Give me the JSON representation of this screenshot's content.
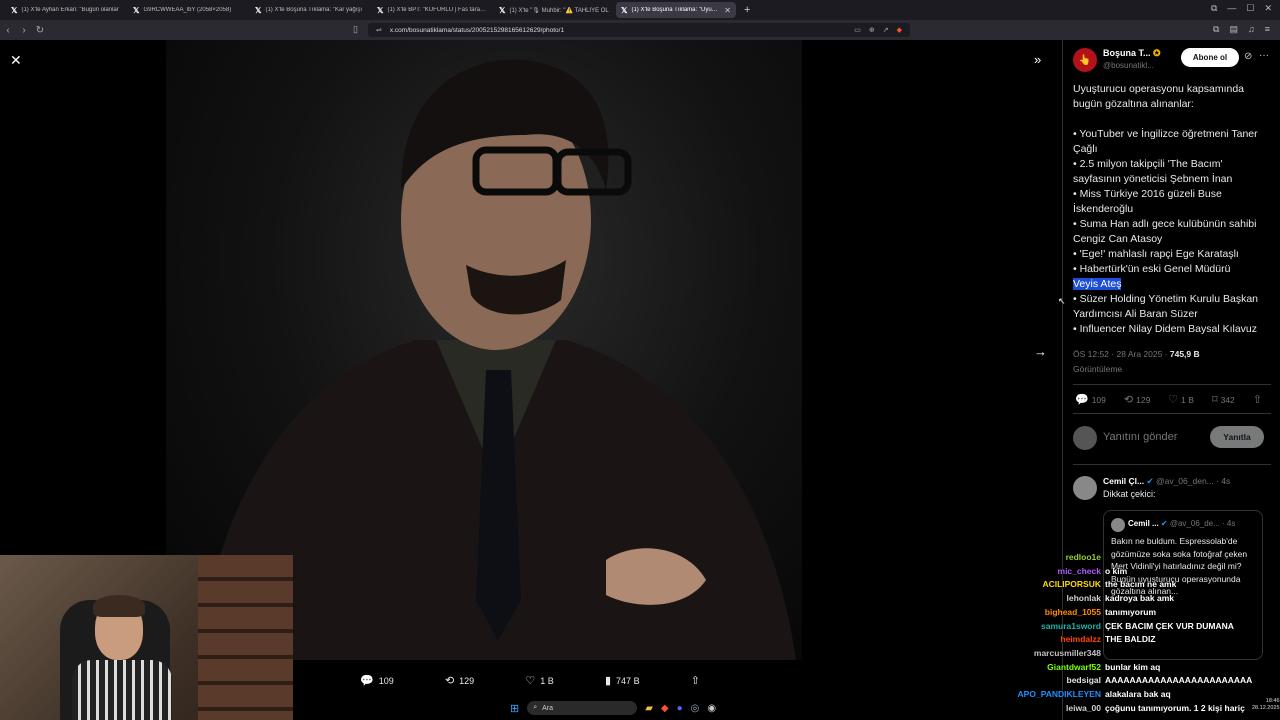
{
  "browser": {
    "tabs": [
      {
        "label": "(1) X'te Ayhan Erkan: \"Bugün olanlar"
      },
      {
        "label": "G9RCWWEAA_lbY (2058×2058)"
      },
      {
        "label": "(1) X'te Boşuna Tıklama: \"Kar yağışı"
      },
      {
        "label": "(1) X'te BPT: \"KÜFÜRLÜ | Fas taraftarlar"
      },
      {
        "label": "(1) X'te \"🎙 Muhbir: \"⚠️ TAHLİYE OL"
      },
      {
        "label": "(1) X'te Boşuna Tıklama: \"Uyuşturucu",
        "active": true
      }
    ],
    "url": "x.com/bosunatiklama/status/2005215298165612629/photo/1"
  },
  "viewer": {
    "replies": "109",
    "reposts": "129",
    "likes": "1 B",
    "views": "747 B"
  },
  "tweet": {
    "name": "Boşuna T...",
    "handle": "@bosunatikl...",
    "follow_label": "Abone ol",
    "lines": [
      "Uyuşturucu operasyonu kapsamında",
      "bugün gözaltına alınanlar:",
      "",
      "• YouTuber ve İngilizce öğretmeni Taner",
      "Çağlı",
      "• 2.5 milyon takipçili 'The Bacım'",
      "sayfasının yöneticisi Şebnem İnan",
      "• Miss Türkiye 2016 güzeli Buse",
      "İskenderoğlu",
      "• Suma Han adlı gece kulübünün sahibi",
      "Cengiz Can Atasoy",
      "• 'Ege!' mahlaslı rapçi Ege Karataşlı",
      "• Habertürk'ün eski Genel Müdürü"
    ],
    "selected_line": "Veyis Ateş",
    "lines_after": [
      "• Süzer Holding Yönetim Kurulu Başkan",
      "Yardımcısı Ali Baran Süzer",
      "• Influencer Nilay Didem Baysal Kılavuz"
    ],
    "time": "ÖS 12:52 · 28 Ara 2025 · ",
    "views_count": "745,9 B",
    "views_label": "Görüntüleme",
    "stat_replies": "109",
    "stat_reposts": "129",
    "stat_likes": "1 B",
    "stat_bookmarks": "342",
    "reply_placeholder": "Yanıtını gönder",
    "reply_button": "Yanıtla"
  },
  "comment": {
    "name": "Cemil Çl...",
    "handle": "@av_06_den...",
    "age": "· 4s",
    "text": "Dikkat çekici:",
    "quote_name": "Cemil ...",
    "quote_handle": "@av_06_de...",
    "quote_age": "· 4s",
    "quote_text": "Bakın ne buldum. Espressolab'de gözümüze soka soka fotoğraf çeken Mert Vidinli'yi hatırladınız değil mi? Bugün uyuşturucu operasyonunda gözaltına alınan..."
  },
  "chat": [
    {
      "user": "redloo1e",
      "color": "#9acd32",
      "msg": ""
    },
    {
      "user": "mic_check",
      "color": "#b05cff",
      "msg": "o kim"
    },
    {
      "user": "ACILIPORSUK",
      "color": "#ffd700",
      "msg": "the bacım ne amk"
    },
    {
      "user": "lehonlak",
      "color": "#d0d0d0",
      "msg": "kadroya bak amk"
    },
    {
      "user": "bighead_1055",
      "color": "#ff8c00",
      "msg": "tanımıyorum"
    },
    {
      "user": "samura1sword",
      "color": "#20b2aa",
      "msg": "ÇEK BACIM ÇEK VUR DUMANA"
    },
    {
      "user": "heimdalzz",
      "color": "#ff4500",
      "msg": "THE BALDIZ"
    },
    {
      "user": "marcusmiller348",
      "color": "#c0c0c0",
      "msg": ""
    },
    {
      "user": "Giantdwarf52",
      "color": "#7fff00",
      "msg": "bunlar kim aq"
    },
    {
      "user": "bedsigal",
      "color": "#e0e0e0",
      "msg": "AAAAAAAAAAAAAAAAAAAAAAAA"
    },
    {
      "user": "APO_PANDIKLEYEN",
      "color": "#1e90ff",
      "msg": "alakalara bak aq"
    },
    {
      "user": "leiwa_00",
      "color": "#d0d0d0",
      "msg": "çoğunu tanımıyorum. 1 2 kişi hariç"
    }
  ],
  "taskbar": {
    "search_placeholder": "Ara",
    "time": "18:46",
    "date": "28.12.2025"
  }
}
